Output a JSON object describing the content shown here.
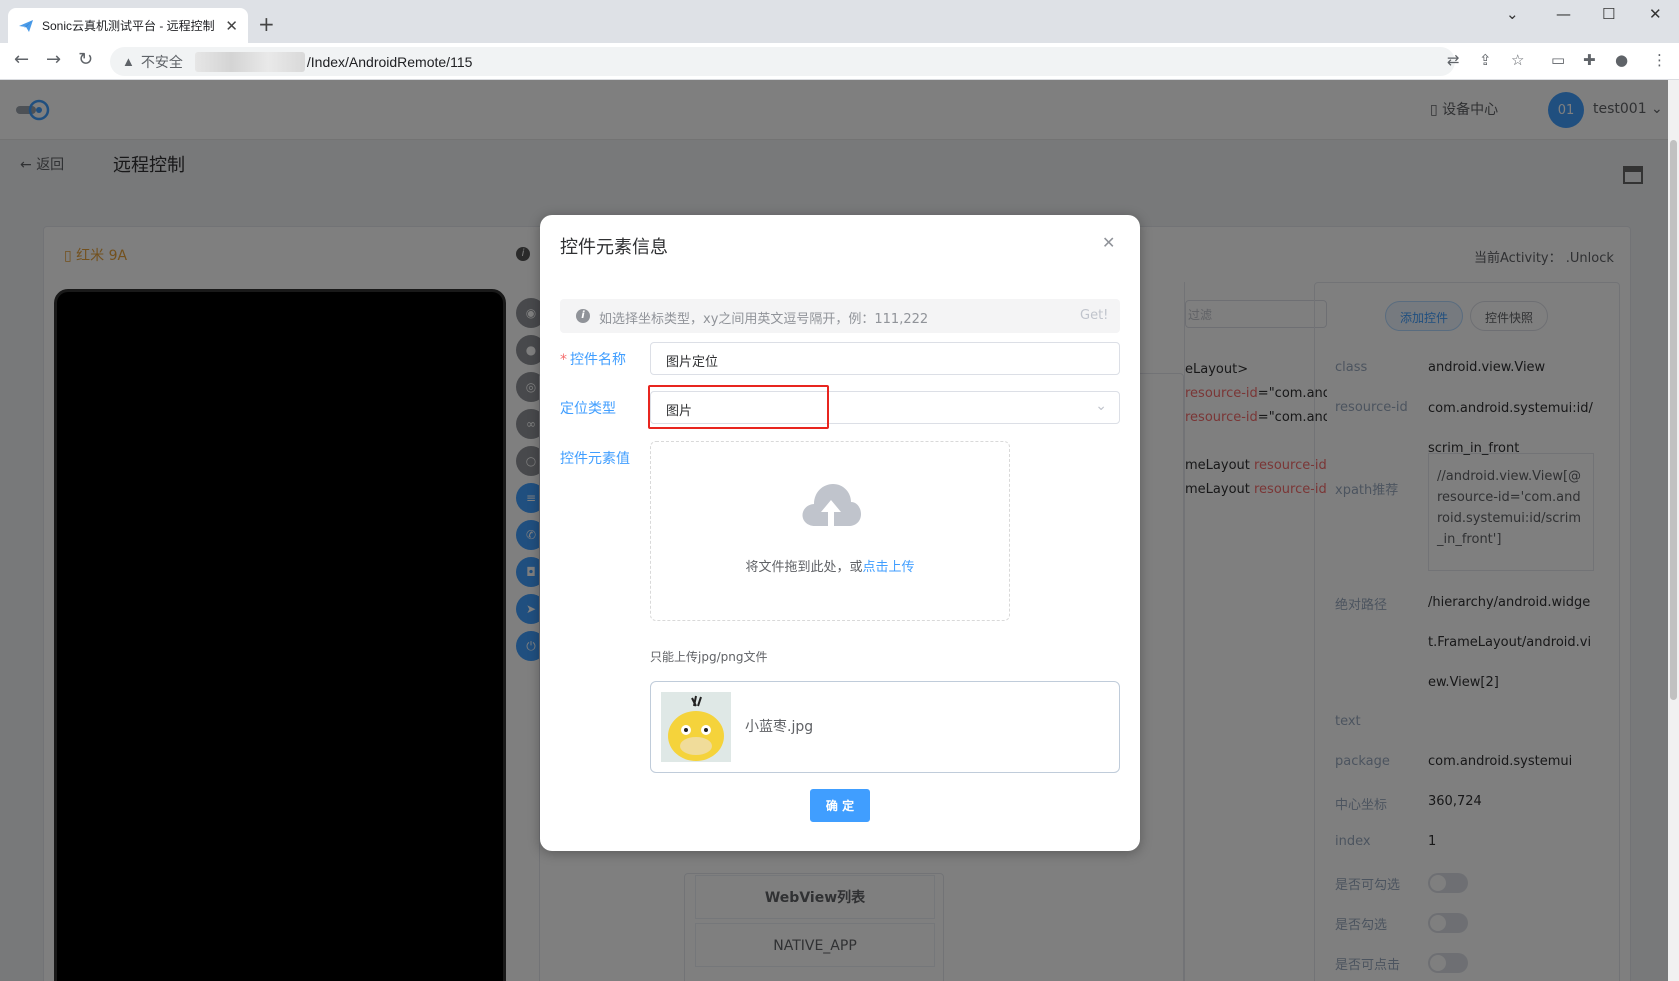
{
  "browser": {
    "tab_title": "Sonic云真机测试平台 - 远程控制",
    "insecure_label": "不安全",
    "url_path": "/Index/AndroidRemote/115"
  },
  "header": {
    "device_center": "设备中心",
    "avatar_text": "01",
    "username": "test001"
  },
  "page": {
    "back_label": "返回",
    "title": "远程控制"
  },
  "device": {
    "name": "红米 9A",
    "current_activity": "当前Activity： .Unlock"
  },
  "tree": {
    "filter_placeholder": "过滤",
    "lines": [
      {
        "text": "eLayout>",
        "attr": ""
      },
      {
        "text": "",
        "attr": "resource-id",
        "rest": "=\"com.andro"
      },
      {
        "text": "",
        "attr": "resource-id",
        "rest": "=\"com.andro"
      },
      {
        "text": "meLayout ",
        "attr": "resource-id",
        "rest": "="
      },
      {
        "text": "meLayout ",
        "attr": "resource-id",
        "rest": "="
      }
    ]
  },
  "attr_panel": {
    "add_button": "添加控件",
    "snapshot_button": "控件快照",
    "class_key": "class",
    "class_val": "android.view.View",
    "resid_key": "resource-id",
    "resid_val": "com.android.systemui:id/scrim_in_front",
    "xpath_key": "xpath推荐",
    "xpath_val": "//android.view.View[@resource-id='com.android.systemui:id/scrim_in_front']",
    "abspath_key": "绝对路径",
    "abspath_val": "/hierarchy/android.widget.FrameLayout/android.view.View[2]",
    "text_key": "text",
    "package_key": "package",
    "package_val": "com.android.systemui",
    "center_key": "中心坐标",
    "center_val": "360,724",
    "index_key": "index",
    "index_val": "1",
    "checkable_key": "是否可勾选",
    "checked_key": "是否勾选",
    "clickable_key": "是否可点击"
  },
  "context": {
    "webview_label": "WebView列表",
    "native_label": "NATIVE_APP"
  },
  "dialog": {
    "title": "控件元素信息",
    "alert_text": "如选择坐标类型，xy之间用英文逗号隔开，例：111,222",
    "alert_get": "Get!",
    "name_label": "控件名称",
    "name_value": "图片定位",
    "type_label": "定位类型",
    "type_value": "图片",
    "value_label": "控件元素值",
    "upload_text": "将文件拖到此处，或",
    "upload_link": "点击上传",
    "upload_tip": "只能上传jpg/png文件",
    "file_name": "小蓝枣.jpg",
    "confirm_label": "确 定"
  },
  "colors": {
    "primary": "#409eff",
    "highlight_border": "#e8251f",
    "required": "#f56c6c"
  }
}
